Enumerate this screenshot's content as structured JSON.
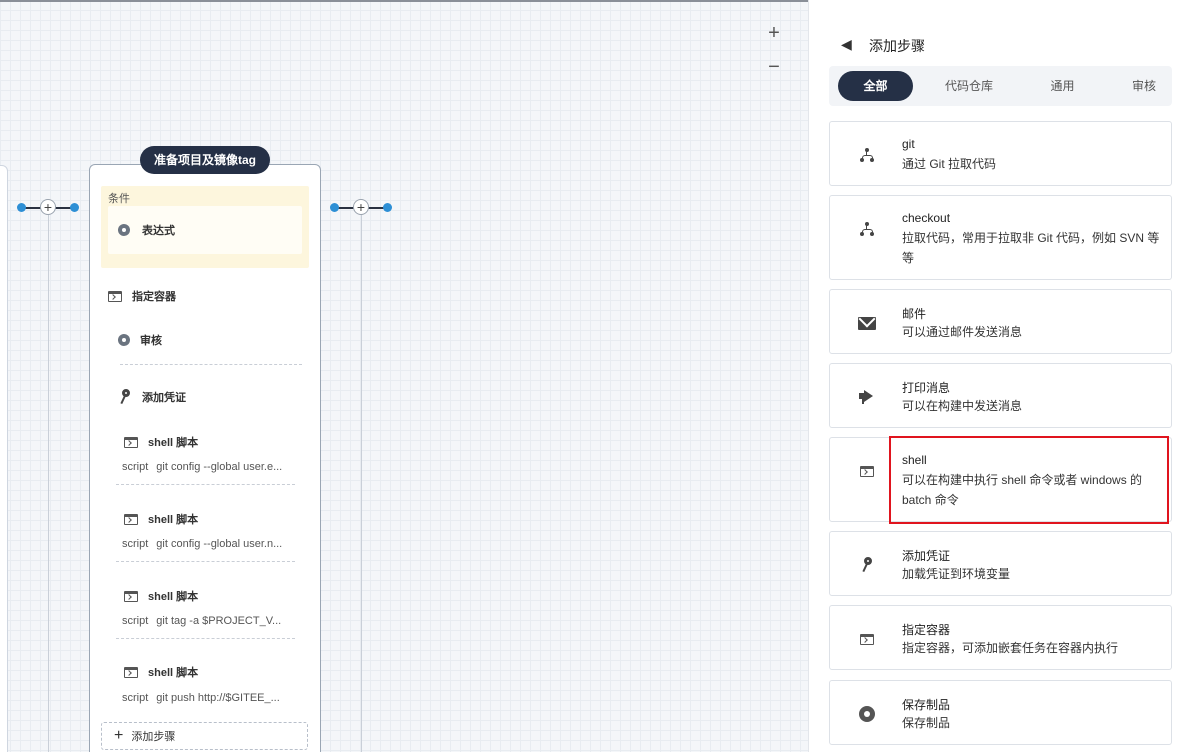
{
  "canvas": {
    "zoom_in": "+",
    "zoom_out": "−",
    "plus": "+",
    "stage": {
      "title": "准备项目及镜像tag",
      "condition_label": "条件",
      "condition_item": "表达式",
      "steps": {
        "container": "指定容器",
        "review": "审核",
        "credential": "添加凭证",
        "shell_label": "shell 脚本",
        "script_kw": "script"
      },
      "scripts": [
        "git config --global user.e...",
        "git config --global user.n...",
        "git tag -a $PROJECT_V...",
        "git push http://$GITEE_..."
      ],
      "add_step": "添加步骤",
      "add_step_plus": "+"
    }
  },
  "panel": {
    "back_icon": "◀",
    "title": "添加步骤",
    "tabs": [
      "全部",
      "代码仓库",
      "通用",
      "审核"
    ],
    "active_tab": "全部",
    "cards": [
      {
        "title": "git",
        "desc": "通过 Git 拉取代码",
        "icon": "git-branch-icon"
      },
      {
        "title": "checkout",
        "desc": "拉取代码，常用于拉取非 Git 代码，例如 SVN 等等",
        "icon": "git-branch-icon"
      },
      {
        "title": "邮件",
        "desc": "可以通过邮件发送消息",
        "icon": "mail-icon"
      },
      {
        "title": "打印消息",
        "desc": "可以在构建中发送消息",
        "icon": "megaphone-icon"
      },
      {
        "title": "shell",
        "desc": "可以在构建中执行 shell 命令或者 windows 的 batch 命令",
        "icon": "terminal-icon"
      },
      {
        "title": "添加凭证",
        "desc": "加载凭证到环境变量",
        "icon": "key-icon"
      },
      {
        "title": "指定容器",
        "desc": "指定容器，可添加嵌套任务在容器内执行",
        "icon": "terminal-icon"
      },
      {
        "title": "保存制品",
        "desc": "保存制品",
        "icon": "artifact-icon"
      }
    ],
    "highlight_color": "#e0141e",
    "accent": "#253046"
  }
}
